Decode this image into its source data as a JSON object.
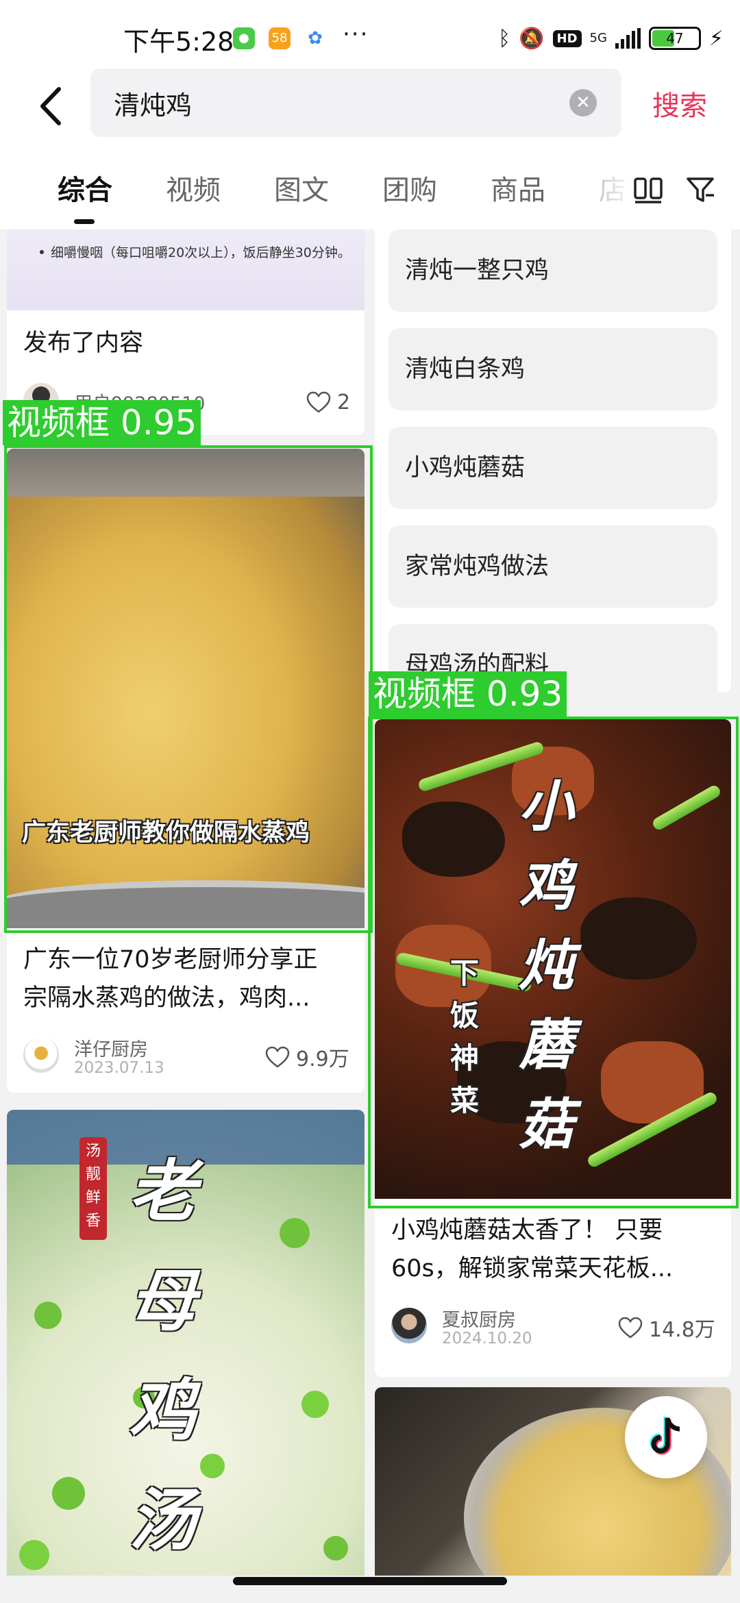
{
  "status_bar": {
    "time": "下午5:28",
    "app_badges": [
      "58"
    ],
    "overflow": "···",
    "hd": "HD",
    "network": "5G",
    "battery_percent": "47",
    "battery_level": 0.47
  },
  "search": {
    "back_icon": "chevron-left-icon",
    "query": "清炖鸡",
    "clear_icon": "clear-icon",
    "submit_label": "搜索"
  },
  "tabs": [
    {
      "label": "综合",
      "active": true
    },
    {
      "label": "视频",
      "active": false
    },
    {
      "label": "图文",
      "active": false
    },
    {
      "label": "团购",
      "active": false
    },
    {
      "label": "商品",
      "active": false
    },
    {
      "label": "店",
      "active": false
    }
  ],
  "feed": {
    "left": {
      "top_card": {
        "snippet": "细嚼慢咽（每口咀嚼20次以上），饭后静坐30分钟。",
        "title": "发布了内容",
        "author": "用户99280510",
        "likes": "2"
      },
      "video_card": {
        "overlay": "广东老厨师教你做隔水蒸鸡",
        "title_line1": "广东一位70岁老厨师分享正",
        "title_line2": "宗隔水蒸鸡的做法，鸡肉...",
        "author": "洋仔厨房",
        "date": "2023.07.13",
        "likes": "9.9万"
      },
      "soup_card": {
        "overlay": "老母鸡汤",
        "seal": "汤靓鲜香"
      }
    },
    "right": {
      "suggestions": [
        "清炖一整只鸡",
        "清炖白条鸡",
        "小鸡炖蘑菇",
        "家常炖鸡做法",
        "母鸡汤的配料"
      ],
      "video_card": {
        "overlay_main": "小鸡炖蘑菇",
        "overlay_sub": "下饭神菜",
        "title_line1": "小鸡炖蘑菇太香了！ 只要",
        "title_line2": "60s，解锁家常菜天花板...",
        "author": "夏叔厨房",
        "date": "2024.10.20",
        "likes": "14.8万"
      }
    }
  },
  "detections": [
    {
      "label": "视频框 0.95"
    },
    {
      "label": "视频框 0.93"
    }
  ],
  "colors": {
    "accent": "#e8335a",
    "detection": "#2ecc2e"
  }
}
